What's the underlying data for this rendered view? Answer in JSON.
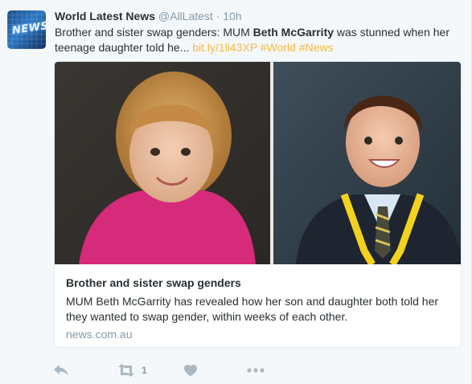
{
  "tweet": {
    "author_name": "World Latest News",
    "author_handle": "@AllLatest",
    "separator": "·",
    "time": "10h",
    "text_prefix": "Brother and sister swap genders: MUM ",
    "text_bold": "Beth McGarrity",
    "text_suffix": " was stunned when her teenage daughter told he... ",
    "link": "bit.ly/1li43XP",
    "hashtags": [
      "#World",
      "#News"
    ]
  },
  "card": {
    "title": "Brother and sister swap genders",
    "description": "MUM Beth McGarrity has revealed how her son and daughter both told her they wanted to swap gender, within weeks of each other.",
    "domain": "news.com.au"
  },
  "actions": {
    "retweet_count": "1",
    "icons": [
      "reply-icon",
      "retweet-icon",
      "like-icon",
      "more-icon"
    ]
  },
  "colors": {
    "link": "#f6b842",
    "muted": "#8899a6",
    "text": "#292f33",
    "icon": "#aab8c2"
  }
}
